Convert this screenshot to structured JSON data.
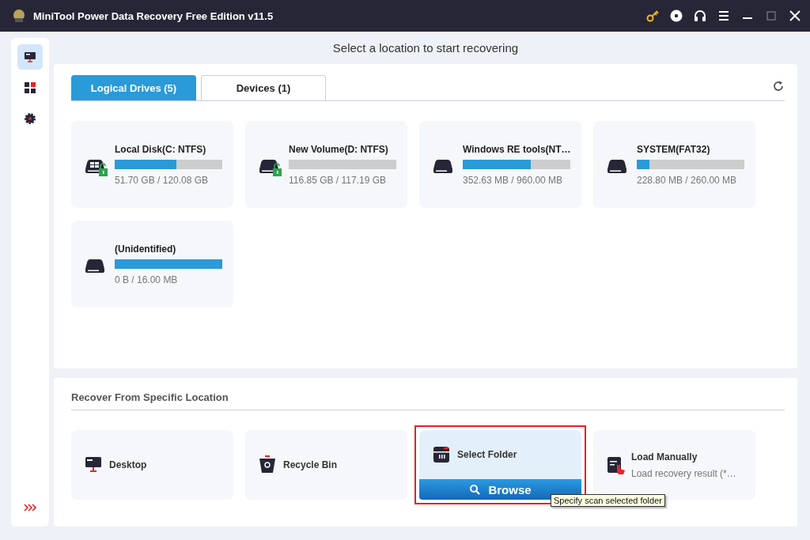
{
  "window": {
    "title": "MiniTool Power Data Recovery Free Edition v11.5"
  },
  "sidebar": {
    "items": [
      {
        "kind": "monitor",
        "selected": true
      },
      {
        "kind": "apps",
        "selected": false
      },
      {
        "kind": "gear",
        "selected": false
      }
    ]
  },
  "header": "Select a location to start recovering",
  "tabs": [
    {
      "label": "Logical Drives (5)",
      "selected": true
    },
    {
      "label": "Devices (1)",
      "selected": false
    }
  ],
  "drives": [
    {
      "name": "Local Disk(C: NTFS)",
      "kind": "windows-unlocked",
      "level": 0.57,
      "usage": "51.70 GB / 120.08 GB"
    },
    {
      "name": "New Volume(D: NTFS)",
      "kind": "unlocked",
      "level": 0,
      "usage": "116.85 GB / 117.19 GB"
    },
    {
      "name": "Windows RE tools(NT…",
      "kind": "plain",
      "level": 0.63,
      "usage": "352.63 MB / 960.00 MB"
    },
    {
      "name": "SYSTEM(FAT32)",
      "kind": "plain",
      "level": 0.12,
      "usage": "228.80 MB / 260.00 MB"
    },
    {
      "name": "(Unidentified)",
      "kind": "plain",
      "level": 1,
      "usage": "0 B / 16.00 MB"
    }
  ],
  "specific": {
    "title": "Recover From Specific Location",
    "items": [
      {
        "label": "Desktop",
        "kind": "desktop",
        "selected": false,
        "highlighted": false
      },
      {
        "label": "Recycle Bin",
        "kind": "recycle",
        "selected": false,
        "highlighted": false
      },
      {
        "label": "Select Folder",
        "kind": "folder",
        "selected": true,
        "highlighted": true,
        "button": "Browse",
        "tooltip": "Specify scan selected folder"
      },
      {
        "label": "Load Manually",
        "kind": "load",
        "selected": false,
        "highlighted": false,
        "subtitle": "Load recovery result (*…"
      }
    ]
  }
}
